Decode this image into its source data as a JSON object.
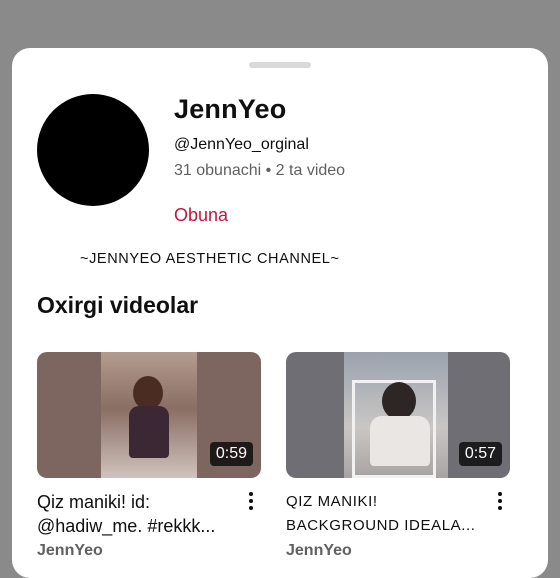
{
  "channel": {
    "name": "JennYeo",
    "handle": "@JennYeo_orginal",
    "meta": "31 obunachi • 2 ta video",
    "subscribe_label": "Obuna",
    "description": "~JENNYEO AESTHETIC CHANNEL~"
  },
  "section": {
    "title": "Oxirgi videolar"
  },
  "videos": [
    {
      "title_line1": "Qiz maniki! id:",
      "title_line2": "@hadiw_me. #rekkk...",
      "duration": "0:59",
      "author": "JennYeo",
      "overlay_top": "",
      "overlay_bottom": ""
    },
    {
      "title_line1": "QIZ MANIKI!",
      "title_line2": "BACKGROUND IDEALA...",
      "duration": "0:57",
      "author": "JennYeo",
      "overlay_top": ""
    }
  ]
}
